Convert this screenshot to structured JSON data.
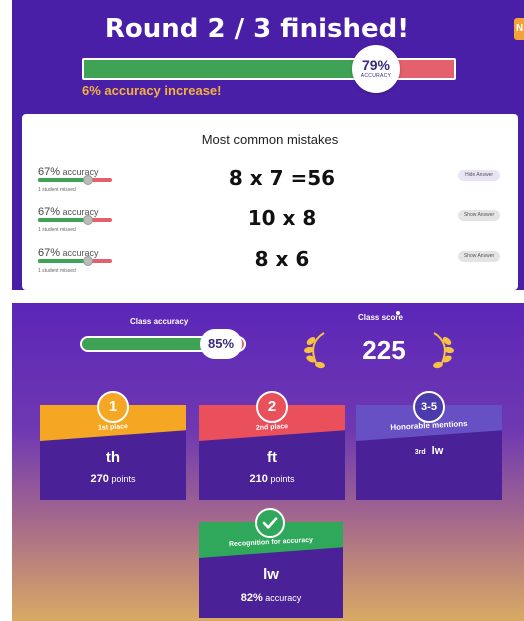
{
  "round": {
    "title": "Round 2 / 3 finished!",
    "side_tab": "N",
    "accuracy_value": "79%",
    "accuracy_fraction": 0.79,
    "accuracy_label": "ACCURACY",
    "increase_text": "6% accuracy increase!"
  },
  "mistakes": {
    "title": "Most common mistakes",
    "rows": [
      {
        "percent": "67%",
        "suffix": "accuracy",
        "fraction": 0.67,
        "missed": "1 student missed",
        "question": "8 x 7  =56",
        "button": "Hide Answer"
      },
      {
        "percent": "67%",
        "suffix": "accuracy",
        "fraction": 0.67,
        "missed": "1 student missed",
        "question": "10 x 8",
        "button": "Show Answer"
      },
      {
        "percent": "67%",
        "suffix": "accuracy",
        "fraction": 0.67,
        "missed": "1 student missed",
        "question": "8 x 6",
        "button": "Show Answer"
      }
    ]
  },
  "class": {
    "accuracy_label": "Class accuracy",
    "accuracy_value": "85%",
    "accuracy_fraction": 0.85,
    "score_label": "Class score",
    "score_value": "225"
  },
  "podium": {
    "first": {
      "rank": "1",
      "label": "1st place",
      "name": "th",
      "points": "270",
      "points_unit": "points"
    },
    "second": {
      "rank": "2",
      "label": "2nd place",
      "name": "ft",
      "points": "210",
      "points_unit": "points"
    },
    "honorable": {
      "rank": "3-5",
      "label": "Honorable mentions",
      "entry_rank": "3rd",
      "entry_name": "lw"
    },
    "accuracy": {
      "label": "Recognition for accuracy",
      "name": "lw",
      "value": "82%",
      "unit": "accuracy"
    }
  },
  "colors": {
    "panel_purple": "#4a1fa8",
    "correct_green": "#3fa356",
    "wrong_red": "#e3606c",
    "gold": "#f5a623",
    "highlight_orange": "#f4b23c"
  }
}
